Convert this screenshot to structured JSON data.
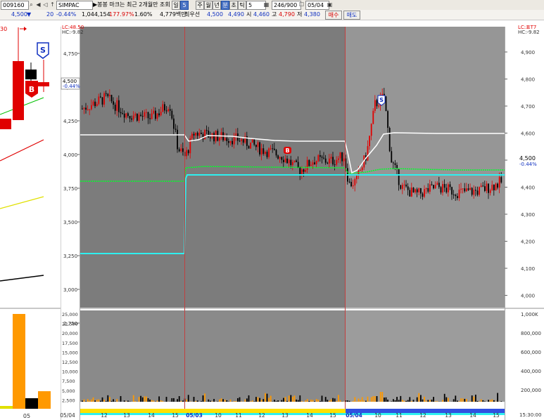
{
  "toolbar": {
    "stock_code": "009160",
    "stock_name": "SIMPAC",
    "period_labels": [
      "일",
      "5",
      "주",
      "월",
      "년"
    ],
    "period_selected": "5",
    "time_buttons": [
      "분",
      "초",
      "틱"
    ],
    "minute_value": "5",
    "count_display": "246/900",
    "date_value": "05/04",
    "bookmark_hint": "▶봉봉 마크는 최근 2개월만 조회",
    "icons": [
      "search-icon",
      "arrow-left-icon",
      "speaker-icon",
      "arrow-up-icon",
      "grid-icon",
      "checkbox-icon",
      "lock-icon"
    ]
  },
  "quote": {
    "price": "4,500",
    "change_arrow": "▼",
    "change": "20",
    "change_pct": "-0.44%",
    "volume": "1,044,154",
    "volume_ratio": "177.97%",
    "turnover_rate": "1.60%",
    "amount": "4,779백만",
    "priority_label": "최우선",
    "best_ask": "4,500",
    "best_bid": "4,490",
    "open_label": "시",
    "open": "4,460",
    "high_label": "고",
    "high": "4,790",
    "low_label": "저",
    "low": "4,380",
    "buy_button": "매수",
    "sell_button": "매도"
  },
  "left_chart": {
    "top_label": "30",
    "buy_marker": "B",
    "sell_marker": "S",
    "bottom_label": "05"
  },
  "middle_chart": {
    "lc_label": "LC:48.50",
    "hc_label": "HC:-9.82",
    "current_price": "4,500",
    "current_change": "-0.44%",
    "buy_marker": "B",
    "sell_marker": "S",
    "y_ticks": [
      "4,750",
      "4,500",
      "4,250",
      "4,000",
      "3,750",
      "3,500",
      "3,250",
      "3,000",
      "2,750"
    ],
    "vol_ticks": [
      "25,000",
      "22,500",
      "20,000",
      "17,500",
      "15,000",
      "12,500",
      "10,000",
      "7,500",
      "5,000",
      "2,500"
    ],
    "x_labels": [
      "05/04",
      "12",
      "13",
      "14",
      "15",
      "05/03",
      "10",
      "11",
      "12",
      "13",
      "14",
      "15",
      "05/04",
      "10",
      "11",
      "12",
      "13",
      "14",
      "15"
    ]
  },
  "right_axis": {
    "lc_label": "LC:표T7",
    "hc_label": "HC:-9.82",
    "y_ticks": [
      "4,900",
      "4,800",
      "4,700",
      "4,600",
      "4,500",
      "4,400",
      "4,300",
      "4,200",
      "4,100",
      "4,000"
    ],
    "current_price": "4,500",
    "current_change": "-0.44%",
    "vol_ticks": [
      "1,000K",
      "800,000",
      "600,000",
      "400,000",
      "200,000"
    ],
    "time_label": "15:30:00"
  },
  "colors": {
    "up": "#e00000",
    "down": "#000000",
    "bg_dark": "#7c7c7c",
    "bg_light": "#969696",
    "white_line": "#ffffff",
    "green_line": "#00ff2a",
    "cyan_line": "#2ef0f0",
    "volume_bar": "#ff9900"
  },
  "chart_data": {
    "type": "candlestick",
    "ylim": [
      2750,
      4900
    ],
    "volume_ylim": [
      0,
      25000
    ],
    "grid": true
  }
}
